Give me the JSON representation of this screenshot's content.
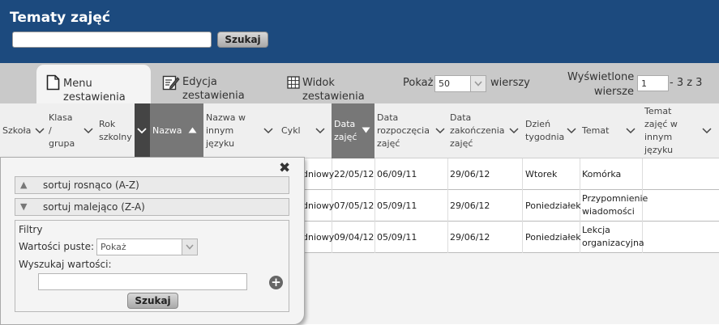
{
  "header": {
    "title": "Tematy zajęć",
    "search_placeholder": "",
    "search_button": "Szukaj"
  },
  "toolbar": {
    "menu": {
      "line1": "Menu",
      "line2": "zestawienia"
    },
    "edit": {
      "line1": "Edycja",
      "line2": "zestawienia"
    },
    "view": {
      "line1": "Widok",
      "line2": "zestawienia"
    },
    "show_label": "Pokaż",
    "show_value": "50",
    "rows_label": "wierszy",
    "displayed_line1": "Wyświetlone",
    "displayed_line2": "wiersze",
    "displayed_from": "1",
    "displayed_range": "- 3 z 3"
  },
  "columns": [
    {
      "id": "szkola",
      "lines": [
        "Szkoła"
      ]
    },
    {
      "id": "klasa",
      "lines": [
        "Klasa",
        "/",
        "grupa"
      ]
    },
    {
      "id": "rok",
      "lines": [
        "Rok",
        "szkolny"
      ]
    },
    {
      "id": "nazwa",
      "lines": [
        "Nazwa"
      ]
    },
    {
      "id": "nazwa-inny",
      "lines": [
        "Nazwa w",
        "innym",
        "języku"
      ]
    },
    {
      "id": "cykl",
      "lines": [
        "Cykl"
      ]
    },
    {
      "id": "data-zajec",
      "lines": [
        "Data",
        "zajęć"
      ]
    },
    {
      "id": "data-rozp",
      "lines": [
        "Data",
        "rozpoczęcia",
        "zajęć"
      ]
    },
    {
      "id": "data-zak",
      "lines": [
        "Data",
        "zakończenia",
        "zajęć"
      ]
    },
    {
      "id": "dzien",
      "lines": [
        "Dzień",
        "tygodnia"
      ]
    },
    {
      "id": "temat",
      "lines": [
        "Temat"
      ]
    },
    {
      "id": "temat-inny",
      "lines": [
        "Temat",
        "zajęć w",
        "innym",
        "języku"
      ]
    }
  ],
  "rows": [
    {
      "cykl_fragment": "dniowy",
      "data_zajec": "22/05/12",
      "data_rozp": "06/09/11",
      "data_zak": "29/06/12",
      "dzien": "Wtorek",
      "temat": [
        "Komórka"
      ]
    },
    {
      "cykl_fragment": "dniowy",
      "data_zajec": "07/05/12",
      "data_rozp": "05/09/11",
      "data_zak": "29/06/12",
      "dzien": "Poniedziałek",
      "temat": [
        "Przypomnienie",
        "wiadomości"
      ]
    },
    {
      "cykl_fragment": "dniowy",
      "data_zajec": "09/04/12",
      "data_rozp": "05/09/11",
      "data_zak": "29/06/12",
      "dzien": "Poniedziałek",
      "temat": [
        "Lekcja",
        "organizacyjna"
      ]
    }
  ],
  "popup": {
    "sort_asc": "sortuj rosnąco (A-Z)",
    "sort_desc": "sortuj malejąco (Z-A)",
    "filters_title": "Filtry",
    "empty_values_label": "Wartości puste:",
    "empty_values_option": "Pokaż",
    "search_values_label": "Wyszukaj wartości:",
    "search_button": "Szukaj"
  }
}
